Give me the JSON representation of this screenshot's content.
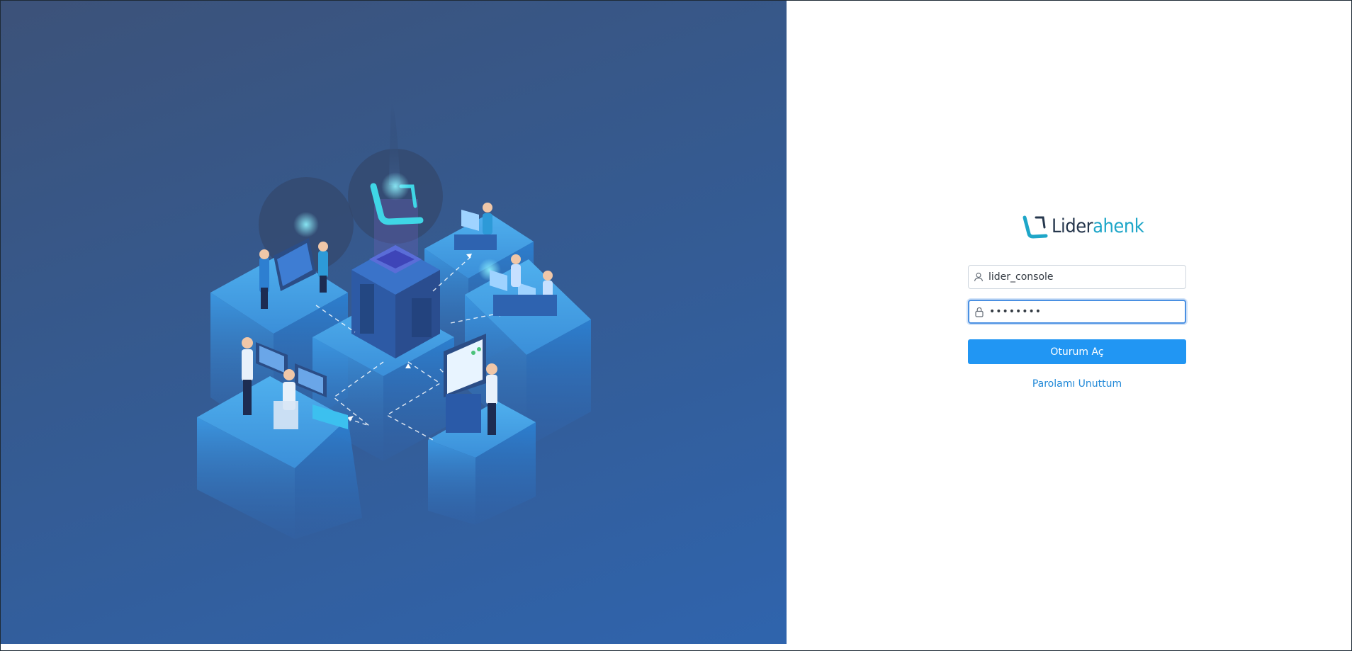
{
  "brand": {
    "name_part1": "Lider",
    "name_part2": "ahenk",
    "dark_color": "#26374d",
    "accent_color": "#1ea6c8"
  },
  "login_form": {
    "username_value": "lider_console",
    "password_value": "••••••••",
    "submit_label": "Oturum Aç",
    "forgot_password_label": "Parolamı Unuttum"
  },
  "icons": {
    "username": "user-icon",
    "password": "lock-icon"
  },
  "colors": {
    "illustration_bg_top": "#3c5279",
    "illustration_bg_bottom": "#2f64ad",
    "button": "#2196f3",
    "link": "#2189d8"
  }
}
